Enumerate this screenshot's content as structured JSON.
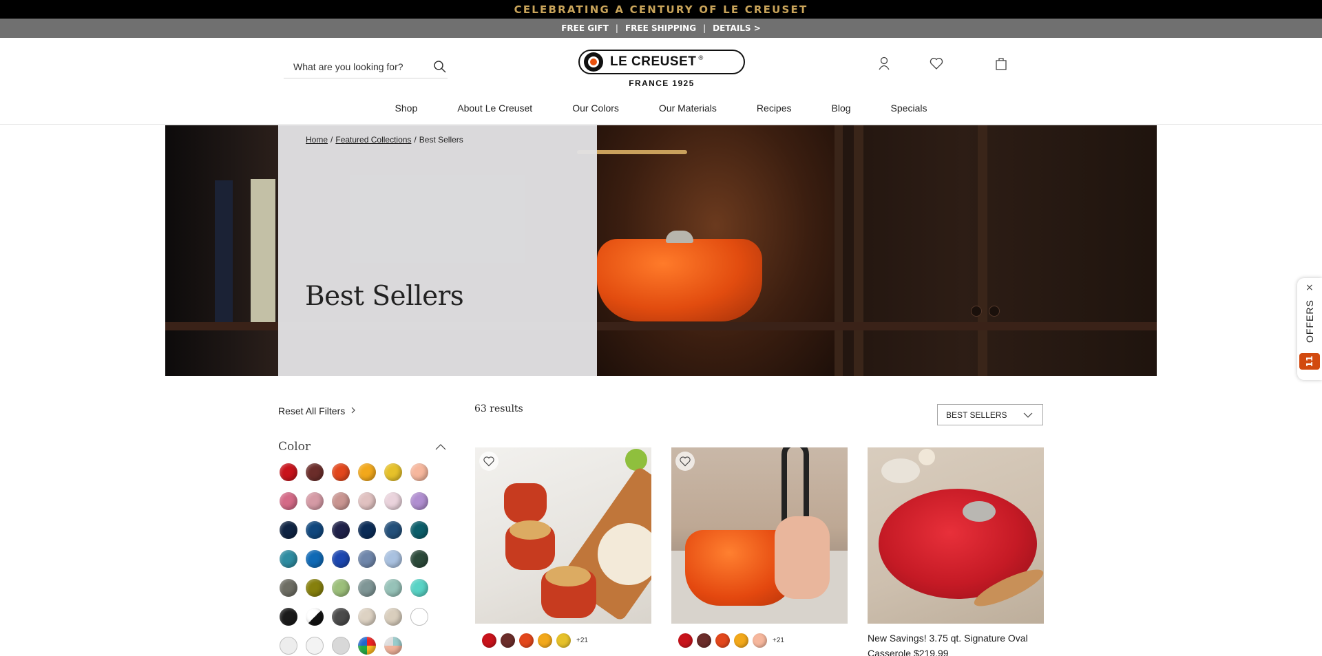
{
  "announcement": "CELEBRATING A CENTURY OF LE CREUSET",
  "promo": {
    "item1": "FREE GIFT",
    "item2": "FREE SHIPPING",
    "item3": "DETAILS >",
    "separator": "|"
  },
  "search": {
    "placeholder": "What are you looking for?"
  },
  "logo": {
    "brand": "LE CREUSET",
    "sub": "FRANCE 1925",
    "reg": "®"
  },
  "header_icons": [
    "account-icon",
    "wishlist-heart-icon",
    "cart-bag-icon"
  ],
  "nav": {
    "items": [
      {
        "label": "Shop"
      },
      {
        "label": "About Le Creuset"
      },
      {
        "label": "Our Colors"
      },
      {
        "label": "Our Materials"
      },
      {
        "label": "Recipes"
      },
      {
        "label": "Blog"
      },
      {
        "label": "Specials"
      }
    ]
  },
  "breadcrumb": {
    "home": "Home",
    "collections": "Featured Collections",
    "current": "Best Sellers",
    "sep": "/"
  },
  "hero": {
    "title": "Best Sellers"
  },
  "offers": {
    "label": "OFFERS",
    "count": "11",
    "close": "×"
  },
  "filters": {
    "reset_label": "Reset All Filters",
    "color_title": "Color",
    "colors": [
      "#c8131b",
      "#6b2d2a",
      "#e2471c",
      "#f2a81b",
      "#e6c12a",
      "#f6b79d",
      "#d46a87",
      "#d59aa5",
      "#c99591",
      "#e0c1c0",
      "#ead3dc",
      "#b08ed0",
      "#0f2443",
      "#10477d",
      "#1f2149",
      "#0b2c57",
      "#24507a",
      "#0c5e6a",
      "#2e8ca1",
      "#0f69b5",
      "#1c47b0",
      "#6f86aa",
      "#a9c1e0",
      "#2c4a3a",
      "#6d6d63",
      "#86800d",
      "#9cbf7a",
      "#7f9696",
      "#96c2b8",
      "#58d3c5",
      "#1a1a1a",
      "#1a1a1a",
      "#4b4b4b",
      "#ddd2c3",
      "#d9cebd",
      "#ffffff",
      "#ededed",
      "#f3f3f3",
      "#d8d8d8",
      "#e34a8f",
      "#f0b29a"
    ]
  },
  "results": {
    "text": "63 results"
  },
  "sort": {
    "label": "BEST SELLERS"
  },
  "products": [
    {
      "name": "",
      "colors": [
        "#c8131b",
        "#6b2d2a",
        "#e2471c",
        "#f2a81b",
        "#e6c12a"
      ],
      "more": "+21"
    },
    {
      "name": "",
      "colors": [
        "#c8131b",
        "#6b2d2a",
        "#e2471c",
        "#f2a81b",
        "#f6b79d"
      ],
      "more": "+21"
    },
    {
      "name": "New Savings! 3.75 qt. Signature Oval Casserole $219.99",
      "colors": [],
      "more": ""
    }
  ]
}
